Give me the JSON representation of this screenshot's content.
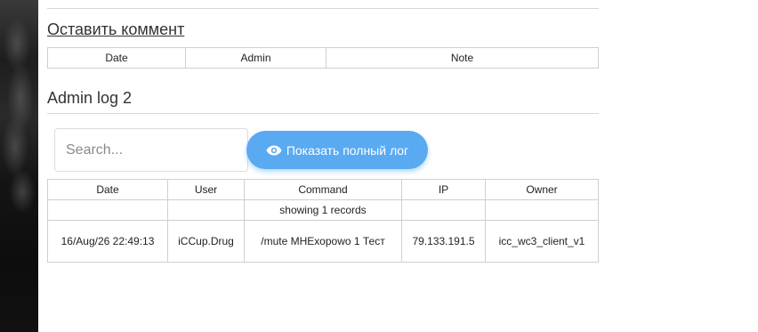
{
  "comment_section": {
    "link_label": "Оставить коммент",
    "columns": [
      "Date",
      "Admin",
      "Note"
    ]
  },
  "admin_log": {
    "title": "Admin log 2",
    "search": {
      "placeholder": "Search...",
      "value": ""
    },
    "show_full_log_button": {
      "label": "Показать полный лог",
      "icon": "eye-icon",
      "color": "#5aaaf2"
    },
    "columns": [
      "Date",
      "User",
      "Command",
      "IP",
      "Owner"
    ],
    "records_text": "showing 1 records",
    "rows": [
      {
        "date": "16/Aug/26 22:49:13",
        "user": "iCCup.Drug",
        "command": "/mute МНЕхоpowo 1 Тест",
        "ip": "79.133.191.5",
        "owner": "icc_wc3_client_v1"
      }
    ]
  }
}
